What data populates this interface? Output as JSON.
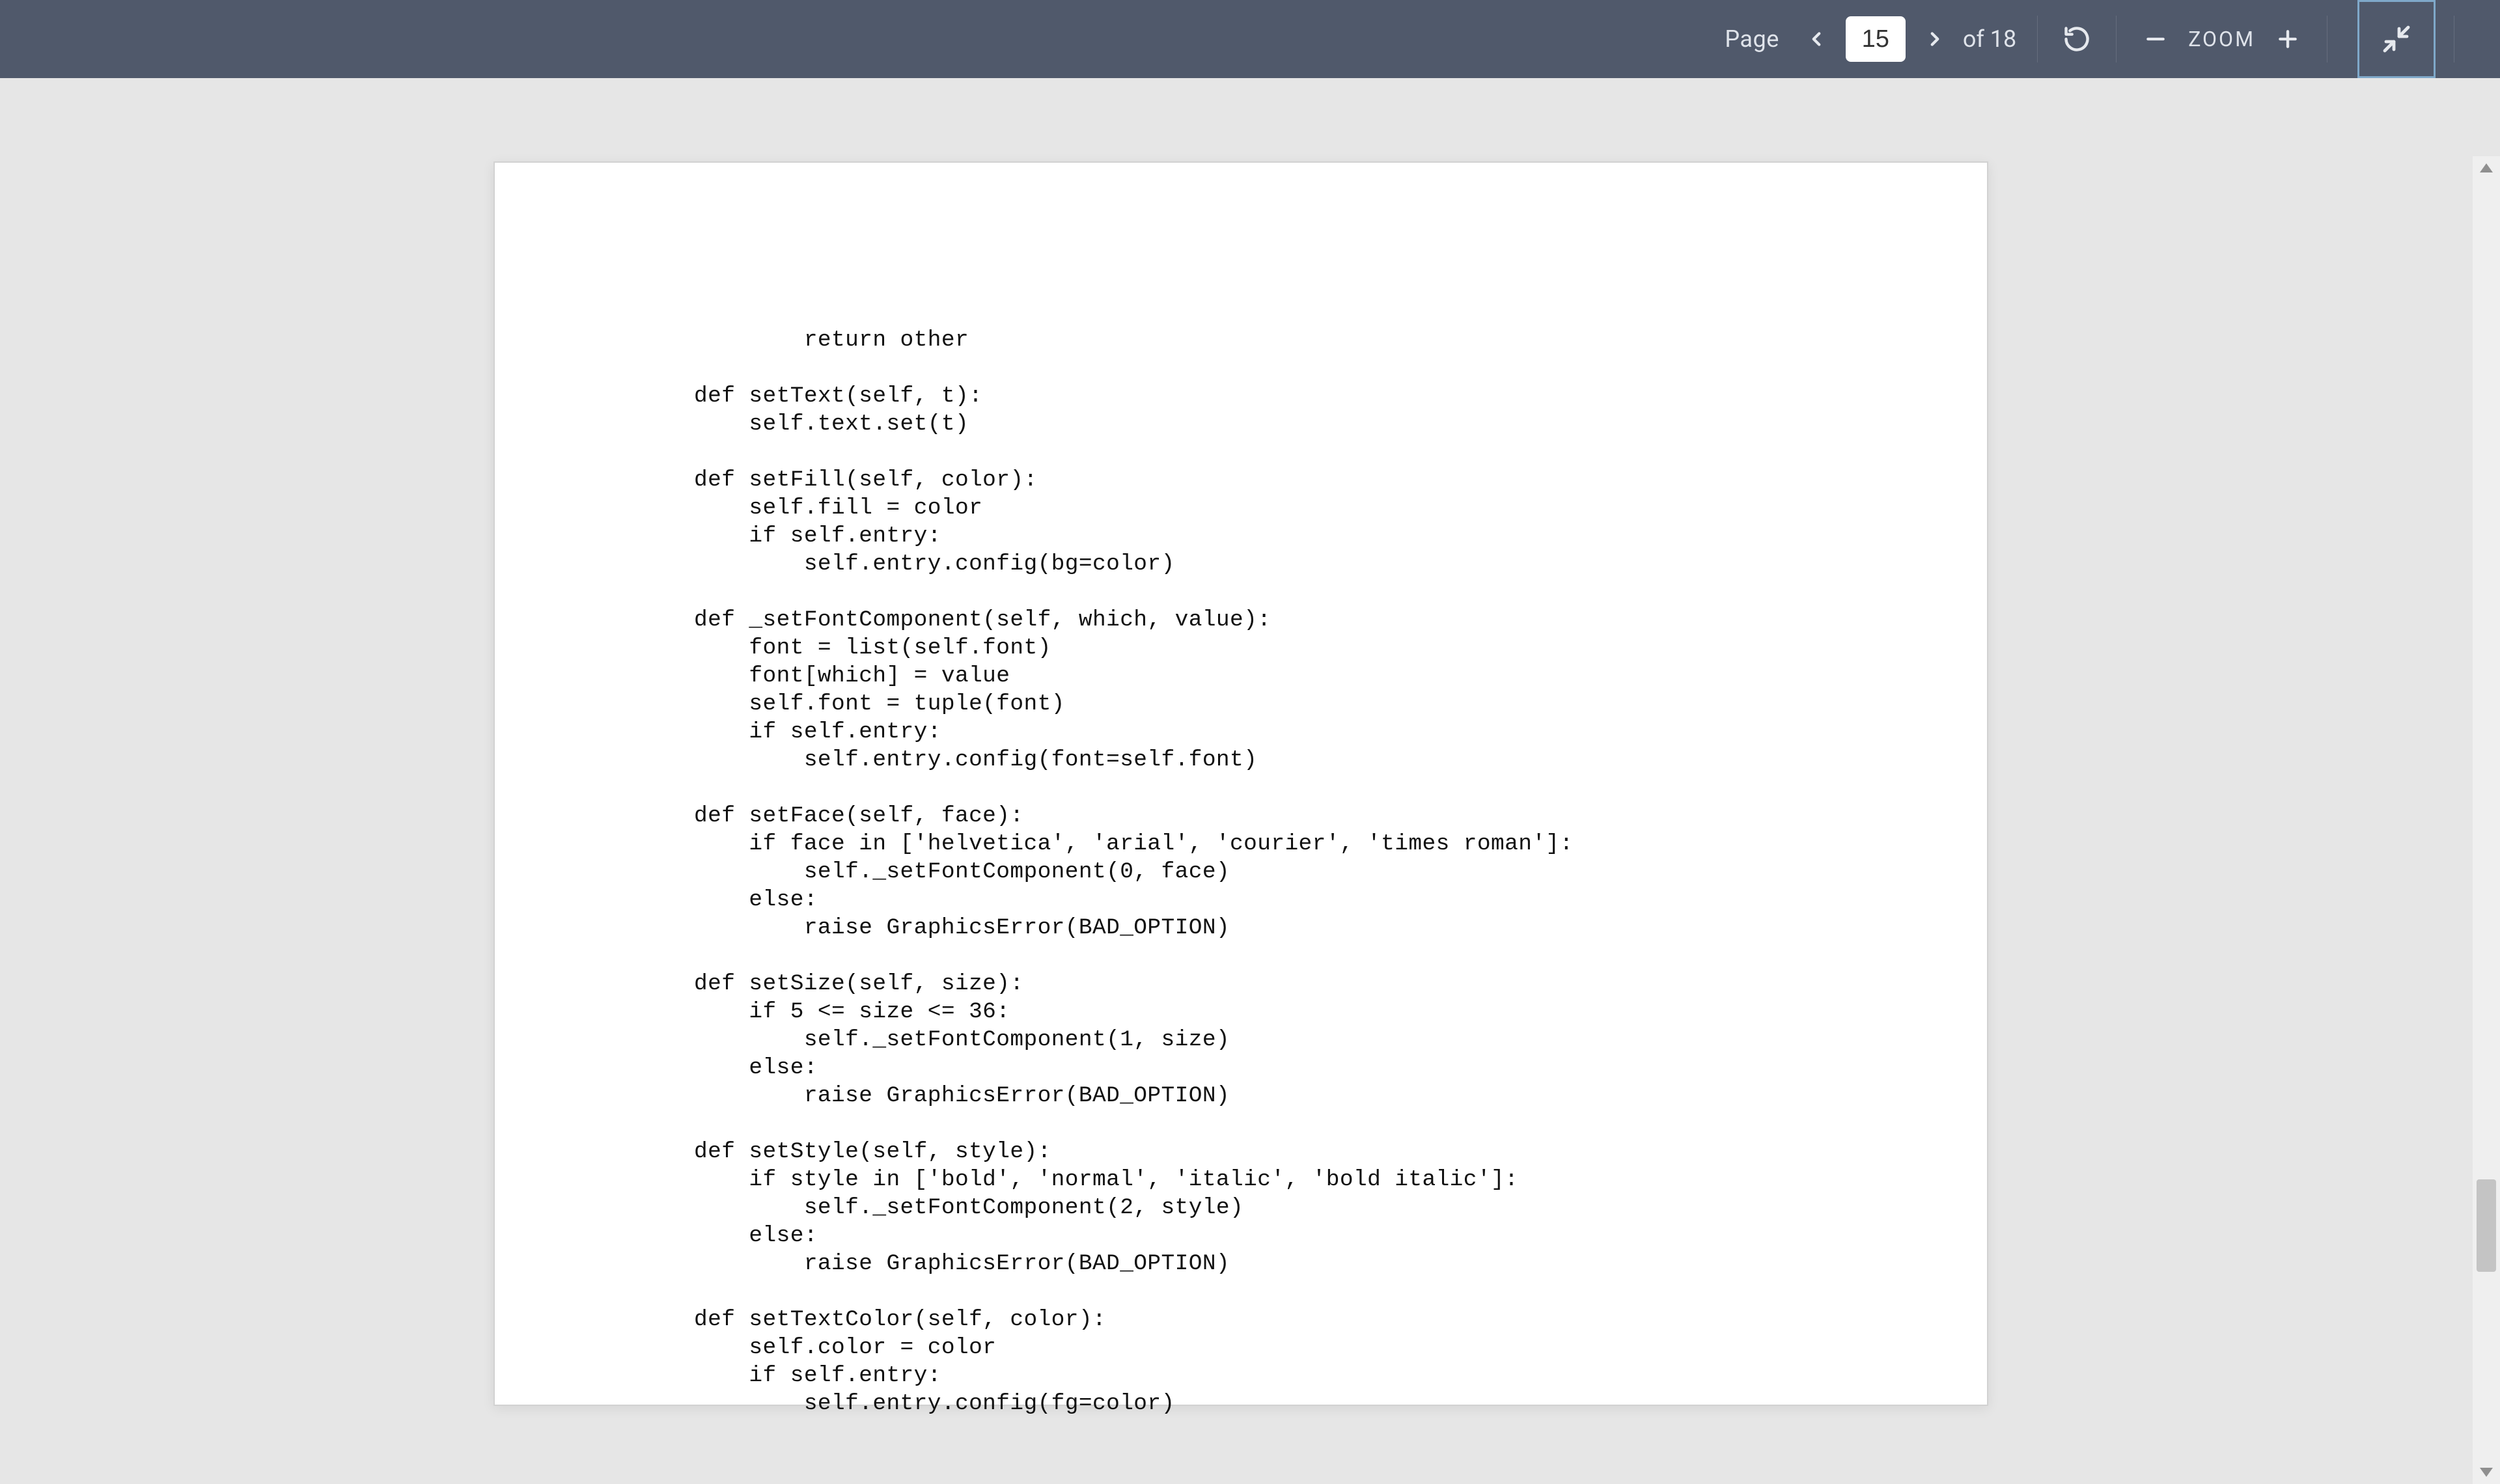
{
  "toolbar": {
    "page_label": "Page",
    "current_page": "15",
    "of_label": "of",
    "total_pages": "18",
    "zoom_label": "ZOOM"
  },
  "document": {
    "code": "        return other\n\ndef setText(self, t):\n    self.text.set(t)\n\ndef setFill(self, color):\n    self.fill = color\n    if self.entry:\n        self.entry.config(bg=color)\n\ndef _setFontComponent(self, which, value):\n    font = list(self.font)\n    font[which] = value\n    self.font = tuple(font)\n    if self.entry:\n        self.entry.config(font=self.font)\n\ndef setFace(self, face):\n    if face in ['helvetica', 'arial', 'courier', 'times roman']:\n        self._setFontComponent(0, face)\n    else:\n        raise GraphicsError(BAD_OPTION)\n\ndef setSize(self, size):\n    if 5 <= size <= 36:\n        self._setFontComponent(1, size)\n    else:\n        raise GraphicsError(BAD_OPTION)\n\ndef setStyle(self, style):\n    if style in ['bold', 'normal', 'italic', 'bold italic']:\n        self._setFontComponent(2, style)\n    else:\n        raise GraphicsError(BAD_OPTION)\n\ndef setTextColor(self, color):\n    self.color = color\n    if self.entry:\n        self.entry.config(fg=color)"
  }
}
